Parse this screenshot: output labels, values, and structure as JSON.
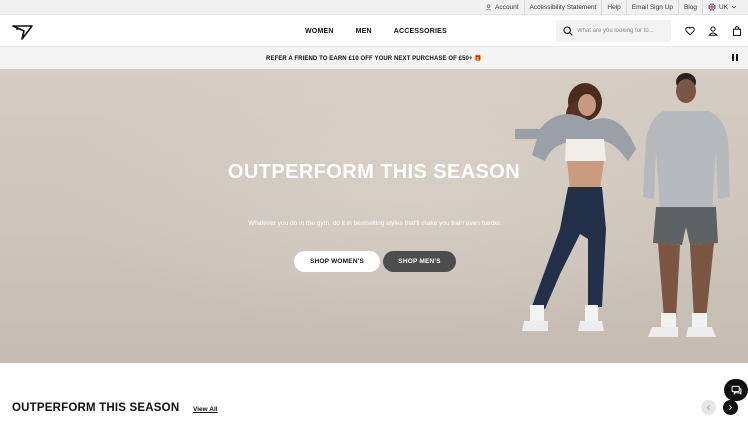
{
  "utility_bar": {
    "account": "Account",
    "accessibility": "Accessibility Statement",
    "help": "Help",
    "email_signup": "Email Sign Up",
    "blog": "Blog",
    "region": "UK"
  },
  "header": {
    "logo_icon": "gymshark-shark-logo",
    "nav": [
      "WOMEN",
      "MEN",
      "ACCESSORIES"
    ],
    "search_placeholder": "What are you looking for to...",
    "icons": [
      "search-icon",
      "heart-icon",
      "user-icon",
      "bag-icon"
    ]
  },
  "promo": {
    "text": "REFER A FRIEND TO EARN £10 OFF YOUR NEXT PURCHASE OF £50+ 🎁"
  },
  "hero": {
    "title": "OUTPERFORM THIS SEASON",
    "subtitle": "Whatever you do in the gym, do it in bestselling styles that'll make you train even harder.",
    "button_women": "SHOP WOMEN'S",
    "button_men": "SHOP MEN'S"
  },
  "section": {
    "title": "OUTPERFORM THIS SEASON",
    "view_all": "View All"
  },
  "colors": {
    "hero_bg": "#cdc5ba",
    "button_dark": "#4d4d4d",
    "text_dark": "#111111"
  }
}
